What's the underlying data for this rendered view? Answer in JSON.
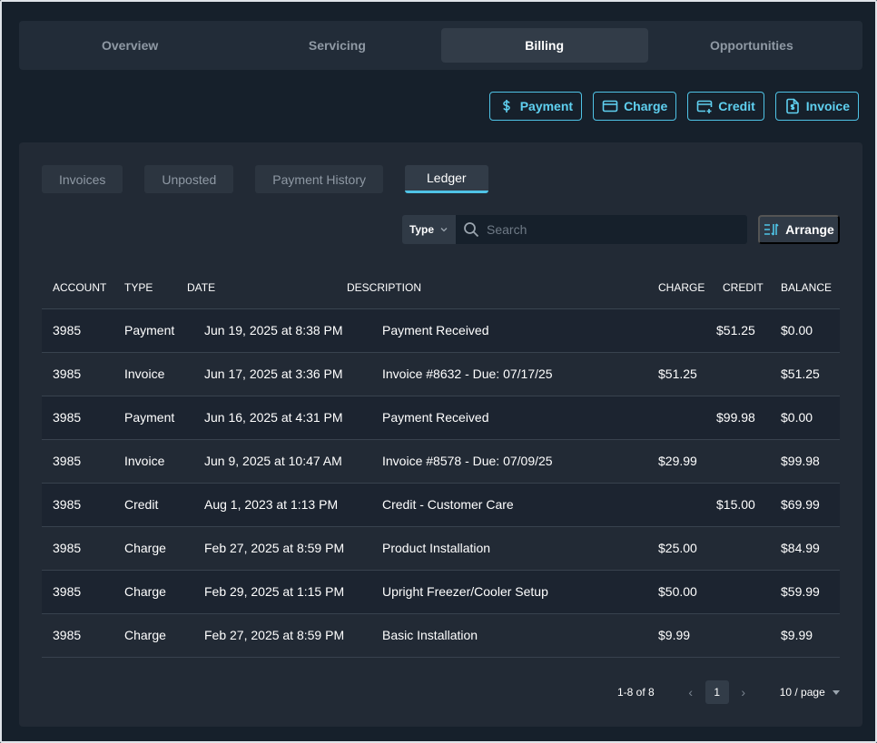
{
  "top_tabs": [
    {
      "label": "Overview"
    },
    {
      "label": "Servicing"
    },
    {
      "label": "Billing"
    },
    {
      "label": "Opportunities"
    }
  ],
  "actions": {
    "payment": "Payment",
    "charge": "Charge",
    "credit": "Credit",
    "invoice": "Invoice"
  },
  "sub_tabs": [
    {
      "label": "Invoices"
    },
    {
      "label": "Unposted"
    },
    {
      "label": "Payment History"
    },
    {
      "label": "Ledger"
    }
  ],
  "filter": {
    "type_label": "Type",
    "search_placeholder": "Search",
    "arrange_label": "Arrange"
  },
  "table": {
    "headers": {
      "account": "ACCOUNT",
      "type": "TYPE",
      "date": "DATE",
      "description": "DESCRIPTION",
      "charge": "CHARGE",
      "credit": "CREDIT",
      "balance": "BALANCE"
    },
    "rows": [
      {
        "account": "3985",
        "type": "Payment",
        "date": "Jun 19, 2025 at 8:38 PM",
        "description": "Payment Received",
        "charge": "",
        "credit": "$51.25",
        "balance": "$0.00"
      },
      {
        "account": "3985",
        "type": "Invoice",
        "date": "Jun 17, 2025 at 3:36 PM",
        "description": "Invoice #8632 - Due: 07/17/25",
        "charge": "$51.25",
        "credit": "",
        "balance": "$51.25"
      },
      {
        "account": "3985",
        "type": "Payment",
        "date": "Jun 16, 2025 at 4:31 PM",
        "description": "Payment Received",
        "charge": "",
        "credit": "$99.98",
        "balance": "$0.00"
      },
      {
        "account": "3985",
        "type": "Invoice",
        "date": "Jun 9, 2025 at 10:47 AM",
        "description": "Invoice #8578 - Due: 07/09/25",
        "charge": "$29.99",
        "credit": "",
        "balance": "$99.98"
      },
      {
        "account": "3985",
        "type": "Credit",
        "date": "Aug 1, 2023 at 1:13 PM",
        "description": "Credit -  Customer Care",
        "charge": "",
        "credit": "$15.00",
        "balance": "$69.99"
      },
      {
        "account": "3985",
        "type": "Charge",
        "date": "Feb 27, 2025 at 8:59 PM",
        "description": "Product Installation",
        "charge": "$25.00",
        "credit": "",
        "balance": "$84.99"
      },
      {
        "account": "3985",
        "type": "Charge",
        "date": "Feb 29, 2025 at 1:15 PM",
        "description": "Upright Freezer/Cooler Setup",
        "charge": "$50.00",
        "credit": "",
        "balance": "$59.99"
      },
      {
        "account": "3985",
        "type": "Charge",
        "date": "Feb 27, 2025 at 8:59 PM",
        "description": "Basic Installation",
        "charge": "$9.99",
        "credit": "",
        "balance": "$9.99"
      }
    ]
  },
  "pagination": {
    "range": "1-8 of 8",
    "current_page": "1",
    "per_page": "10 / page"
  }
}
